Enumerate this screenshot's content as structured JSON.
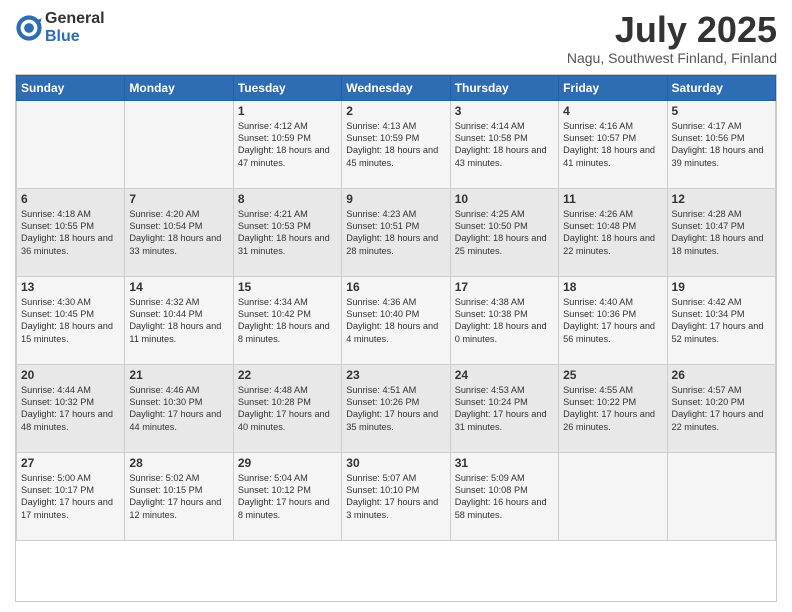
{
  "logo": {
    "general": "General",
    "blue": "Blue"
  },
  "title": "July 2025",
  "location": "Nagu, Southwest Finland, Finland",
  "days": [
    "Sunday",
    "Monday",
    "Tuesday",
    "Wednesday",
    "Thursday",
    "Friday",
    "Saturday"
  ],
  "weeks": [
    [
      {
        "day": "",
        "content": ""
      },
      {
        "day": "",
        "content": ""
      },
      {
        "day": "1",
        "content": "Sunrise: 4:12 AM\nSunset: 10:59 PM\nDaylight: 18 hours and 47 minutes."
      },
      {
        "day": "2",
        "content": "Sunrise: 4:13 AM\nSunset: 10:59 PM\nDaylight: 18 hours and 45 minutes."
      },
      {
        "day": "3",
        "content": "Sunrise: 4:14 AM\nSunset: 10:58 PM\nDaylight: 18 hours and 43 minutes."
      },
      {
        "day": "4",
        "content": "Sunrise: 4:16 AM\nSunset: 10:57 PM\nDaylight: 18 hours and 41 minutes."
      },
      {
        "day": "5",
        "content": "Sunrise: 4:17 AM\nSunset: 10:56 PM\nDaylight: 18 hours and 39 minutes."
      }
    ],
    [
      {
        "day": "6",
        "content": "Sunrise: 4:18 AM\nSunset: 10:55 PM\nDaylight: 18 hours and 36 minutes."
      },
      {
        "day": "7",
        "content": "Sunrise: 4:20 AM\nSunset: 10:54 PM\nDaylight: 18 hours and 33 minutes."
      },
      {
        "day": "8",
        "content": "Sunrise: 4:21 AM\nSunset: 10:53 PM\nDaylight: 18 hours and 31 minutes."
      },
      {
        "day": "9",
        "content": "Sunrise: 4:23 AM\nSunset: 10:51 PM\nDaylight: 18 hours and 28 minutes."
      },
      {
        "day": "10",
        "content": "Sunrise: 4:25 AM\nSunset: 10:50 PM\nDaylight: 18 hours and 25 minutes."
      },
      {
        "day": "11",
        "content": "Sunrise: 4:26 AM\nSunset: 10:48 PM\nDaylight: 18 hours and 22 minutes."
      },
      {
        "day": "12",
        "content": "Sunrise: 4:28 AM\nSunset: 10:47 PM\nDaylight: 18 hours and 18 minutes."
      }
    ],
    [
      {
        "day": "13",
        "content": "Sunrise: 4:30 AM\nSunset: 10:45 PM\nDaylight: 18 hours and 15 minutes."
      },
      {
        "day": "14",
        "content": "Sunrise: 4:32 AM\nSunset: 10:44 PM\nDaylight: 18 hours and 11 minutes."
      },
      {
        "day": "15",
        "content": "Sunrise: 4:34 AM\nSunset: 10:42 PM\nDaylight: 18 hours and 8 minutes."
      },
      {
        "day": "16",
        "content": "Sunrise: 4:36 AM\nSunset: 10:40 PM\nDaylight: 18 hours and 4 minutes."
      },
      {
        "day": "17",
        "content": "Sunrise: 4:38 AM\nSunset: 10:38 PM\nDaylight: 18 hours and 0 minutes."
      },
      {
        "day": "18",
        "content": "Sunrise: 4:40 AM\nSunset: 10:36 PM\nDaylight: 17 hours and 56 minutes."
      },
      {
        "day": "19",
        "content": "Sunrise: 4:42 AM\nSunset: 10:34 PM\nDaylight: 17 hours and 52 minutes."
      }
    ],
    [
      {
        "day": "20",
        "content": "Sunrise: 4:44 AM\nSunset: 10:32 PM\nDaylight: 17 hours and 48 minutes."
      },
      {
        "day": "21",
        "content": "Sunrise: 4:46 AM\nSunset: 10:30 PM\nDaylight: 17 hours and 44 minutes."
      },
      {
        "day": "22",
        "content": "Sunrise: 4:48 AM\nSunset: 10:28 PM\nDaylight: 17 hours and 40 minutes."
      },
      {
        "day": "23",
        "content": "Sunrise: 4:51 AM\nSunset: 10:26 PM\nDaylight: 17 hours and 35 minutes."
      },
      {
        "day": "24",
        "content": "Sunrise: 4:53 AM\nSunset: 10:24 PM\nDaylight: 17 hours and 31 minutes."
      },
      {
        "day": "25",
        "content": "Sunrise: 4:55 AM\nSunset: 10:22 PM\nDaylight: 17 hours and 26 minutes."
      },
      {
        "day": "26",
        "content": "Sunrise: 4:57 AM\nSunset: 10:20 PM\nDaylight: 17 hours and 22 minutes."
      }
    ],
    [
      {
        "day": "27",
        "content": "Sunrise: 5:00 AM\nSunset: 10:17 PM\nDaylight: 17 hours and 17 minutes."
      },
      {
        "day": "28",
        "content": "Sunrise: 5:02 AM\nSunset: 10:15 PM\nDaylight: 17 hours and 12 minutes."
      },
      {
        "day": "29",
        "content": "Sunrise: 5:04 AM\nSunset: 10:12 PM\nDaylight: 17 hours and 8 minutes."
      },
      {
        "day": "30",
        "content": "Sunrise: 5:07 AM\nSunset: 10:10 PM\nDaylight: 17 hours and 3 minutes."
      },
      {
        "day": "31",
        "content": "Sunrise: 5:09 AM\nSunset: 10:08 PM\nDaylight: 16 hours and 58 minutes."
      },
      {
        "day": "",
        "content": ""
      },
      {
        "day": "",
        "content": ""
      }
    ]
  ]
}
